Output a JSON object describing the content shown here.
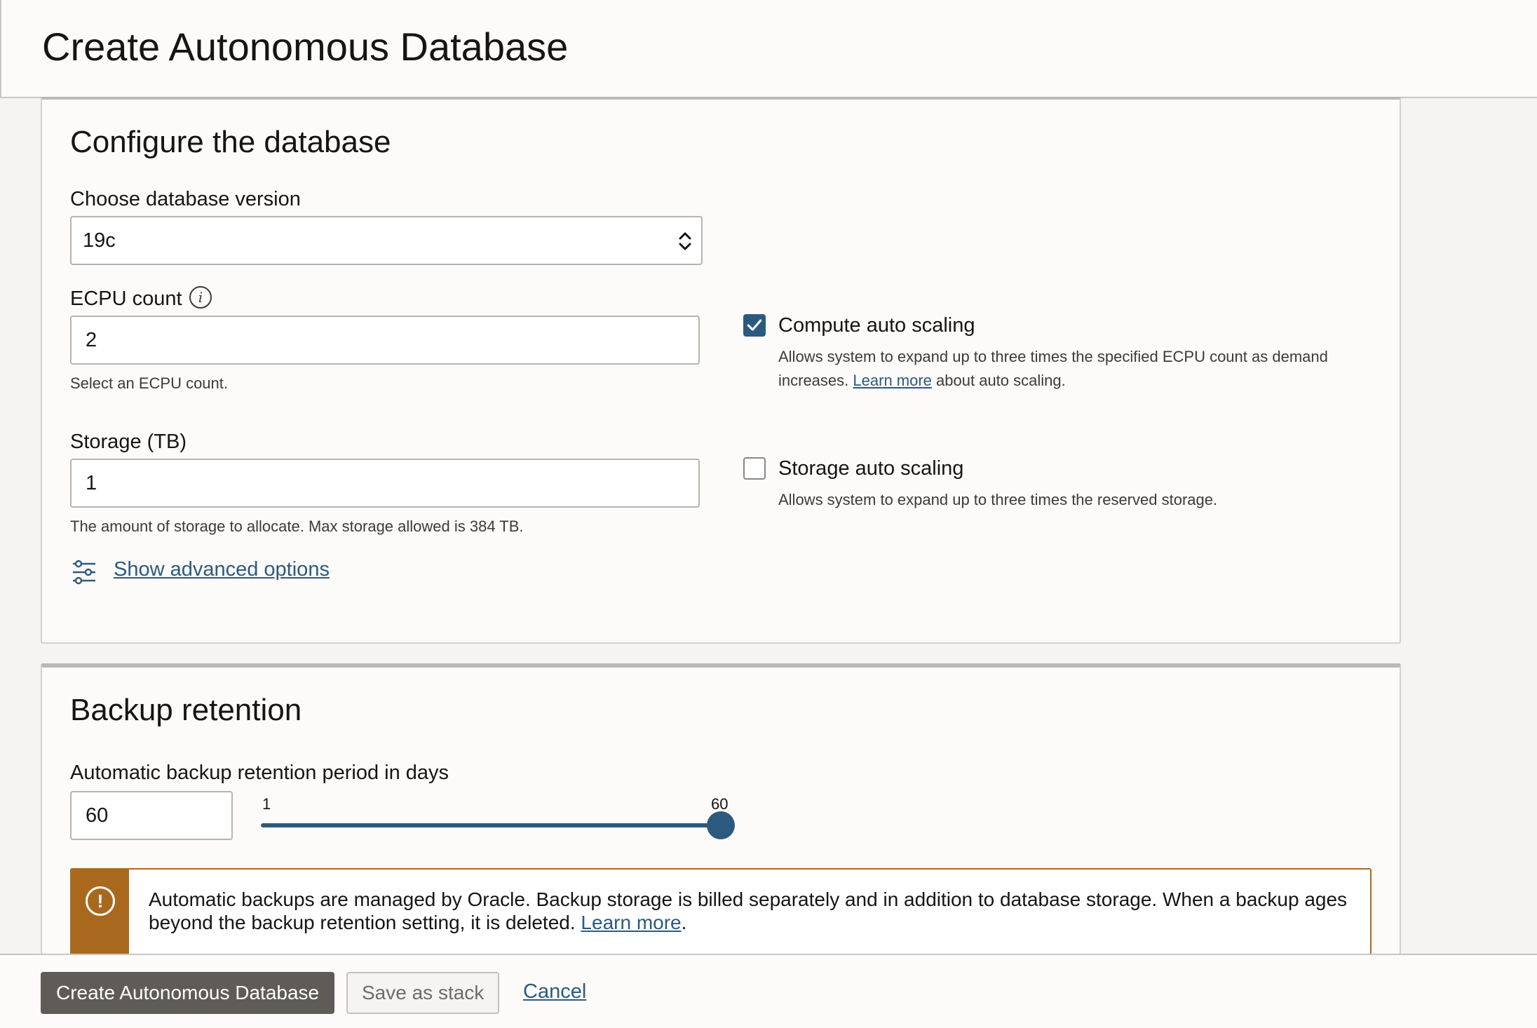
{
  "header": {
    "title": "Create Autonomous Database"
  },
  "configure": {
    "title": "Configure the database",
    "version_label": "Choose database version",
    "version_value": "19c",
    "ecpu_label": "ECPU count",
    "ecpu_value": "2",
    "ecpu_helper": "Select an ECPU count.",
    "storage_label": "Storage (TB)",
    "storage_value": "1",
    "storage_helper": "The amount of storage to allocate. Max storage allowed is 384 TB.",
    "advanced_link": "Show advanced options",
    "compute_scaling": {
      "label": "Compute auto scaling",
      "checked": true,
      "desc_before": "Allows system to expand up to three times the specified ECPU count as demand increases.",
      "link": "Learn more",
      "desc_after": "about auto scaling."
    },
    "storage_scaling": {
      "label": "Storage auto scaling",
      "checked": false,
      "desc": "Allows system to expand up to three times the reserved storage."
    }
  },
  "backup": {
    "title": "Backup retention",
    "period_label": "Automatic backup retention period in days",
    "period_value": "60",
    "slider_min": "1",
    "slider_max": "60",
    "slider_fraction": 1.0,
    "alert_text": "Automatic backups are managed by Oracle. Backup storage is billed separately and in addition to database storage. When a backup ages beyond the backup retention setting, it is deleted.",
    "alert_link": "Learn more",
    "alert_end": "."
  },
  "footer": {
    "create_label": "Create Autonomous Database",
    "stack_label": "Save as stack",
    "cancel_label": "Cancel"
  },
  "colors": {
    "accent": "#2c5a7f",
    "warning": "#a8691f",
    "primary_button": "#5f5c58"
  },
  "icons": {
    "info": "info-icon",
    "check": "checkmark-icon",
    "select": "up-down-chevron-icon",
    "advanced": "sliders-icon",
    "warning": "exclamation-icon"
  }
}
